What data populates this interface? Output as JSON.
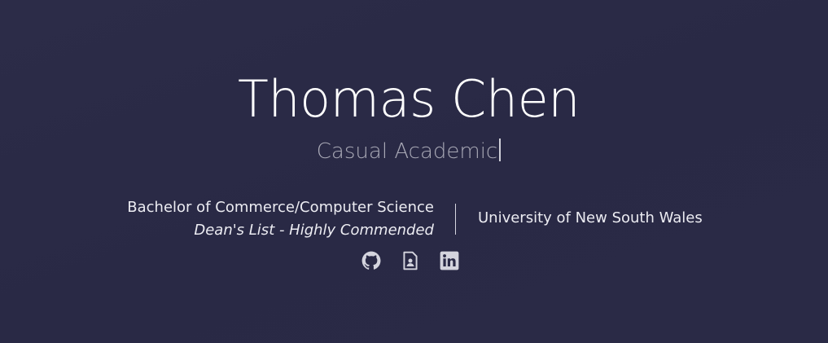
{
  "profile": {
    "name": "Thomas Chen",
    "role": "Casual Academic"
  },
  "education": {
    "degree": "Bachelor of Commerce/Computer Science",
    "honour": "Dean's List - Highly Commended",
    "university": "University of New South Wales"
  },
  "links": [
    {
      "icon": "github-icon"
    },
    {
      "icon": "resume-icon"
    },
    {
      "icon": "linkedin-icon"
    }
  ],
  "colors": {
    "background": "#2a2a46",
    "text": "#ffffff",
    "muted": "#a9a9b6",
    "icon": "#d4d4de"
  }
}
